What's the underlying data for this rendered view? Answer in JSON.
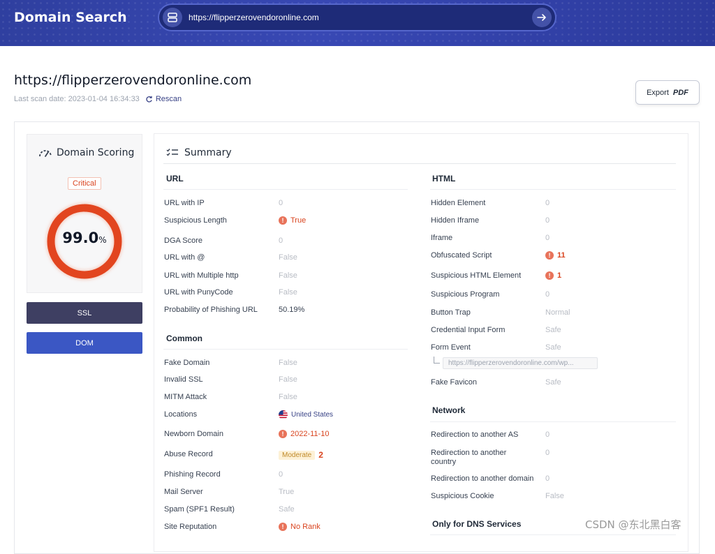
{
  "header": {
    "brand": "Domain Search",
    "search_value": "https://flipperzerovendoronline.com"
  },
  "page": {
    "title": "https://flipperzerovendoronline.com",
    "last_scan": "Last scan date: 2023-01-04 16:34:33",
    "rescan_label": "Rescan",
    "export_label": "Export",
    "export_format": "PDF"
  },
  "scoring": {
    "title": "Domain Scoring",
    "level": "Critical",
    "score": "99.0",
    "unit": "%",
    "score_fraction": 0.99,
    "accent": "#e2451f"
  },
  "side_buttons": {
    "ssl": "SSL",
    "dom": "DOM"
  },
  "summary": {
    "title": "Summary",
    "url": {
      "title": "URL",
      "rows": [
        {
          "label": "URL with IP",
          "value": "0"
        },
        {
          "label": "Suspicious Length",
          "value": "True"
        },
        {
          "label": "DGA Score",
          "value": "0"
        },
        {
          "label": "URL with @",
          "value": "False"
        },
        {
          "label": "URL with Multiple http",
          "value": "False"
        },
        {
          "label": "URL with PunyCode",
          "value": "False"
        },
        {
          "label": "Probability of Phishing URL",
          "value": "50.19%"
        }
      ]
    },
    "common": {
      "title": "Common",
      "rows": [
        {
          "label": "Fake Domain",
          "value": "False"
        },
        {
          "label": "Invalid SSL",
          "value": "False"
        },
        {
          "label": "MITM Attack",
          "value": "False"
        },
        {
          "label": "Locations",
          "value": "United States"
        },
        {
          "label": "Newborn Domain",
          "value": "2022-11-10"
        },
        {
          "label": "Abuse Record",
          "badge": "Moderate",
          "value": "2"
        },
        {
          "label": "Phishing Record",
          "value": "0"
        },
        {
          "label": "Mail Server",
          "value": "True"
        },
        {
          "label": "Spam (SPF1 Result)",
          "value": "Safe"
        },
        {
          "label": "Site Reputation",
          "value": "No Rank"
        }
      ]
    },
    "html": {
      "title": "HTML",
      "rows": [
        {
          "label": "Hidden Element",
          "value": "0"
        },
        {
          "label": "Hidden Iframe",
          "value": "0"
        },
        {
          "label": "Iframe",
          "value": "0"
        },
        {
          "label": "Obfuscated Script",
          "value": "11"
        },
        {
          "label": "Suspicious HTML Element",
          "value": "1"
        },
        {
          "label": "Suspicious Program",
          "value": "0"
        },
        {
          "label": "Button Trap",
          "value": "Normal"
        },
        {
          "label": "Credential Input Form",
          "value": "Safe"
        },
        {
          "label": "Form Event",
          "value": "Safe"
        },
        {
          "label": "Fake Favicon",
          "value": "Safe"
        }
      ],
      "form_event_url": "https://flipperzerovendoronline.com/wp..."
    },
    "network": {
      "title": "Network",
      "rows": [
        {
          "label": "Redirection to another AS",
          "value": "0"
        },
        {
          "label": "Redirection to another country",
          "value": "0"
        },
        {
          "label": "Redirection to another domain",
          "value": "0"
        },
        {
          "label": "Suspicious Cookie",
          "value": "False"
        }
      ]
    },
    "dns": {
      "title": "Only for DNS Services"
    }
  },
  "watermark": "CSDN @东北黑白客"
}
